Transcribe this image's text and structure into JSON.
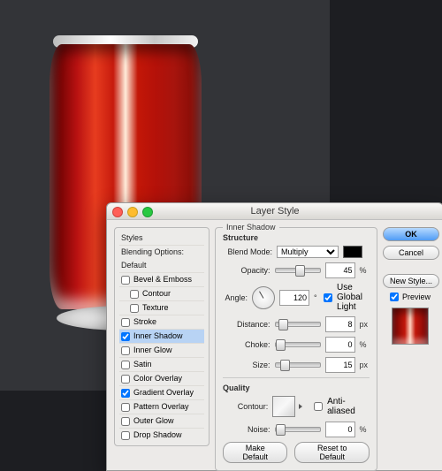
{
  "dialog": {
    "title": "Layer Style"
  },
  "styles_panel": {
    "header": "Styles",
    "subheader": "Blending Options: Default",
    "items": [
      {
        "label": "Bevel & Emboss",
        "checked": false,
        "selected": false,
        "indent": false
      },
      {
        "label": "Contour",
        "checked": false,
        "selected": false,
        "indent": true
      },
      {
        "label": "Texture",
        "checked": false,
        "selected": false,
        "indent": true
      },
      {
        "label": "Stroke",
        "checked": false,
        "selected": false,
        "indent": false
      },
      {
        "label": "Inner Shadow",
        "checked": true,
        "selected": true,
        "indent": false
      },
      {
        "label": "Inner Glow",
        "checked": false,
        "selected": false,
        "indent": false
      },
      {
        "label": "Satin",
        "checked": false,
        "selected": false,
        "indent": false
      },
      {
        "label": "Color Overlay",
        "checked": false,
        "selected": false,
        "indent": false
      },
      {
        "label": "Gradient Overlay",
        "checked": true,
        "selected": false,
        "indent": false
      },
      {
        "label": "Pattern Overlay",
        "checked": false,
        "selected": false,
        "indent": false
      },
      {
        "label": "Outer Glow",
        "checked": false,
        "selected": false,
        "indent": false
      },
      {
        "label": "Drop Shadow",
        "checked": false,
        "selected": false,
        "indent": false
      }
    ]
  },
  "inner_shadow": {
    "group_title": "Inner Shadow",
    "structure_title": "Structure",
    "quality_title": "Quality",
    "blend_mode_label": "Blend Mode:",
    "blend_mode_value": "Multiply",
    "opacity_label": "Opacity:",
    "opacity_value": "45",
    "opacity_unit": "%",
    "angle_label": "Angle:",
    "angle_value": "120",
    "angle_unit": "°",
    "global_light_label": "Use Global Light",
    "global_light_checked": true,
    "distance_label": "Distance:",
    "distance_value": "8",
    "distance_unit": "px",
    "choke_label": "Choke:",
    "choke_value": "0",
    "choke_unit": "%",
    "size_label": "Size:",
    "size_value": "15",
    "size_unit": "px",
    "contour_label": "Contour:",
    "antialiased_label": "Anti-aliased",
    "antialiased_checked": false,
    "noise_label": "Noise:",
    "noise_value": "0",
    "noise_unit": "%",
    "make_default": "Make Default",
    "reset_default": "Reset to Default",
    "color_swatch": "#000000"
  },
  "buttons": {
    "ok": "OK",
    "cancel": "Cancel",
    "new_style": "New Style...",
    "preview_label": "Preview",
    "preview_checked": true
  }
}
